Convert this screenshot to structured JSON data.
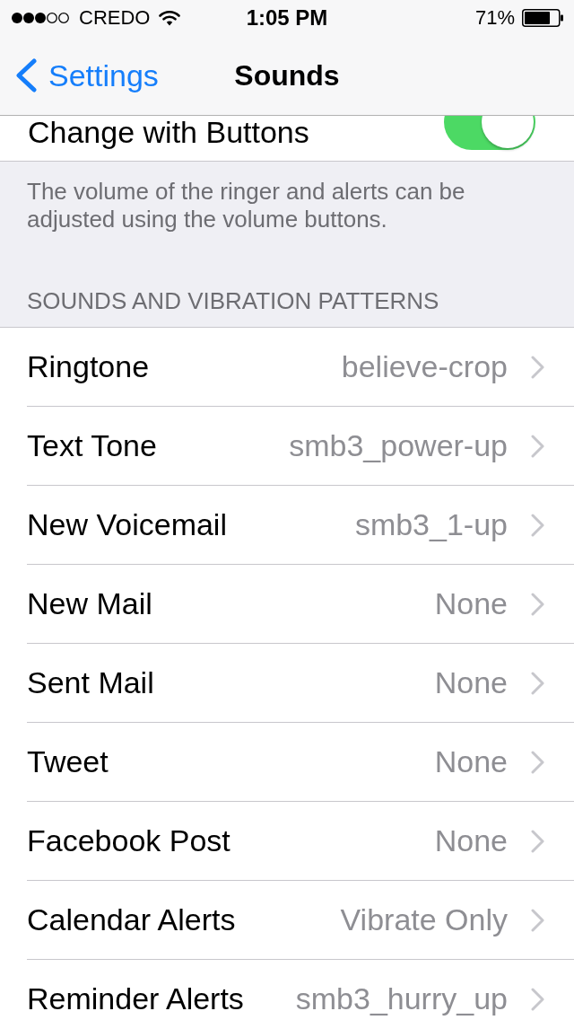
{
  "status_bar": {
    "carrier": "CREDO",
    "time": "1:05 PM",
    "battery": "71%"
  },
  "nav_bar": {
    "back": "Settings",
    "title": "Sounds"
  },
  "toggle_row": {
    "label": "Change with Buttons",
    "on": true
  },
  "footer": "The volume of the ringer and alerts can be adjusted using the volume buttons.",
  "section_header": "SOUNDS AND VIBRATION PATTERNS",
  "rows": [
    {
      "label": "Ringtone",
      "value": "believe-crop"
    },
    {
      "label": "Text Tone",
      "value": "smb3_power-up"
    },
    {
      "label": "New Voicemail",
      "value": "smb3_1-up"
    },
    {
      "label": "New Mail",
      "value": "None"
    },
    {
      "label": "Sent Mail",
      "value": "None"
    },
    {
      "label": "Tweet",
      "value": "None"
    },
    {
      "label": "Facebook Post",
      "value": "None"
    },
    {
      "label": "Calendar Alerts",
      "value": "Vibrate Only"
    },
    {
      "label": "Reminder Alerts",
      "value": "smb3_hurry_up"
    }
  ]
}
